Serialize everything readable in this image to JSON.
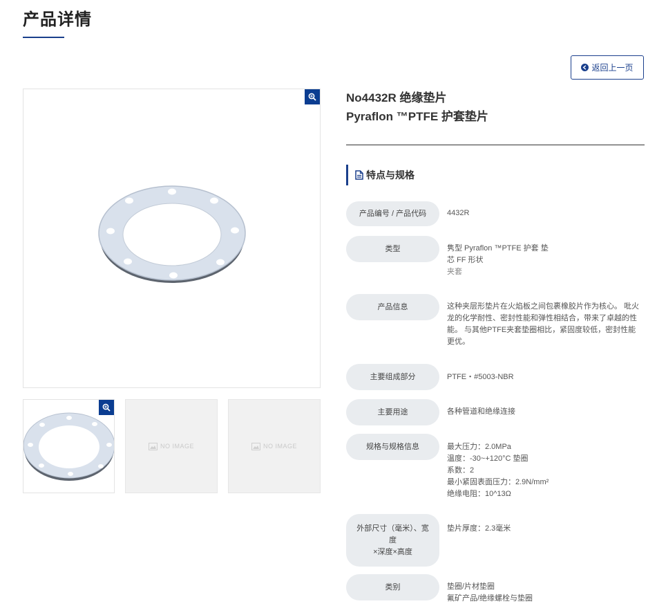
{
  "page": {
    "title": "产品详情"
  },
  "back_button": {
    "label": "返回上一页",
    "icon": "arrow-circle-left-icon"
  },
  "gallery": {
    "main_image_alt": "",
    "zoom_icon": "zoom-in-icon",
    "thumbnails": [
      {
        "type": "image"
      },
      {
        "type": "placeholder",
        "label": "NO IMAGE"
      },
      {
        "type": "placeholder",
        "label": "NO IMAGE"
      }
    ]
  },
  "product": {
    "name_line1": "No4432R 绝缘垫片",
    "name_line2": "Pyraflon ™PTFE 护套垫片"
  },
  "specs_section": {
    "title": "特点与规格",
    "icon": "document-icon"
  },
  "specs": [
    {
      "label": "产品编号 / 产品代码",
      "values": [
        "4432R"
      ]
    },
    {
      "label": "类型",
      "values": [
        "隽型 Pyraflon ™PTFE 护套 垫",
        "芯 FF 形状",
        "夹套"
      ]
    },
    {
      "label": "产品信息",
      "values": [
        "这种夹层形垫片在火焰板之间包裹橡胶片作为核心。 吡火",
        "龙的化学耐性、密封性能和弹性相结合，带来了卓越的性",
        "能。 与其他PTFE夹套垫圈相比，紧固度较低，密封性能",
        "更优。"
      ]
    },
    {
      "label": "主要组成部分",
      "values": [
        "PTFE・#5003-NBR"
      ]
    },
    {
      "label": "主要用途",
      "values": [
        "各种管道和绝缘连接"
      ]
    },
    {
      "label": "规格与规格信息",
      "values": [
        "最大压力：2.0MPa",
        "温度：-30~+120°C 垫圈",
        "系数：2",
        "最小紧固表面压力：2.9N/mm²",
        "绝缘电阻：10^13Ω"
      ]
    },
    {
      "label_lines": [
        "外部尺寸（毫米）、宽",
        "度",
        "×深度×高度"
      ],
      "values": [
        "垫片厚度：2.3毫米"
      ]
    },
    {
      "label": "类别",
      "values": [
        "垫圈/片材垫圈",
        "氟矿产品/绝缘螺栓与垫圈"
      ]
    }
  ],
  "colors": {
    "accent": "#1a3f8c",
    "zoom_bg": "#0b3d91",
    "label_bg": "#e9ecef"
  }
}
